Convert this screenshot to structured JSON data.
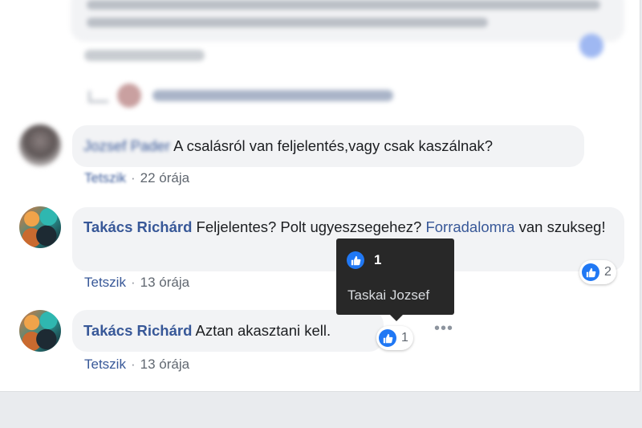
{
  "comments": [
    {
      "author": "Jozsef Pader",
      "text": "A csalásról van feljelentés,vagy csak kaszálnak?",
      "like_label": "Tetszik",
      "time": "22 órája"
    },
    {
      "author": "Takács Richárd",
      "text_before_link": "Feljelentes? Polt ugyeszsegehez?",
      "link_text": "Forradalomra",
      "text_after_link": "van szukseg!",
      "like_label": "Tetszik",
      "time": "13 órája",
      "reaction_count": "2"
    },
    {
      "author": "Takács Richárd",
      "text": "Aztan akasztani kell.",
      "like_label": "Tetszik",
      "time": "13 órája",
      "reaction_count": "1"
    }
  ],
  "tooltip": {
    "count": "1",
    "name": "Taskai Jozsef"
  },
  "icons": {
    "like": "thumbs-up-icon",
    "more": "more-options-icon"
  },
  "colors": {
    "link": "#385898",
    "like_blue": "#2078f4",
    "bubble": "#f2f3f5",
    "tooltip": "#282828"
  }
}
